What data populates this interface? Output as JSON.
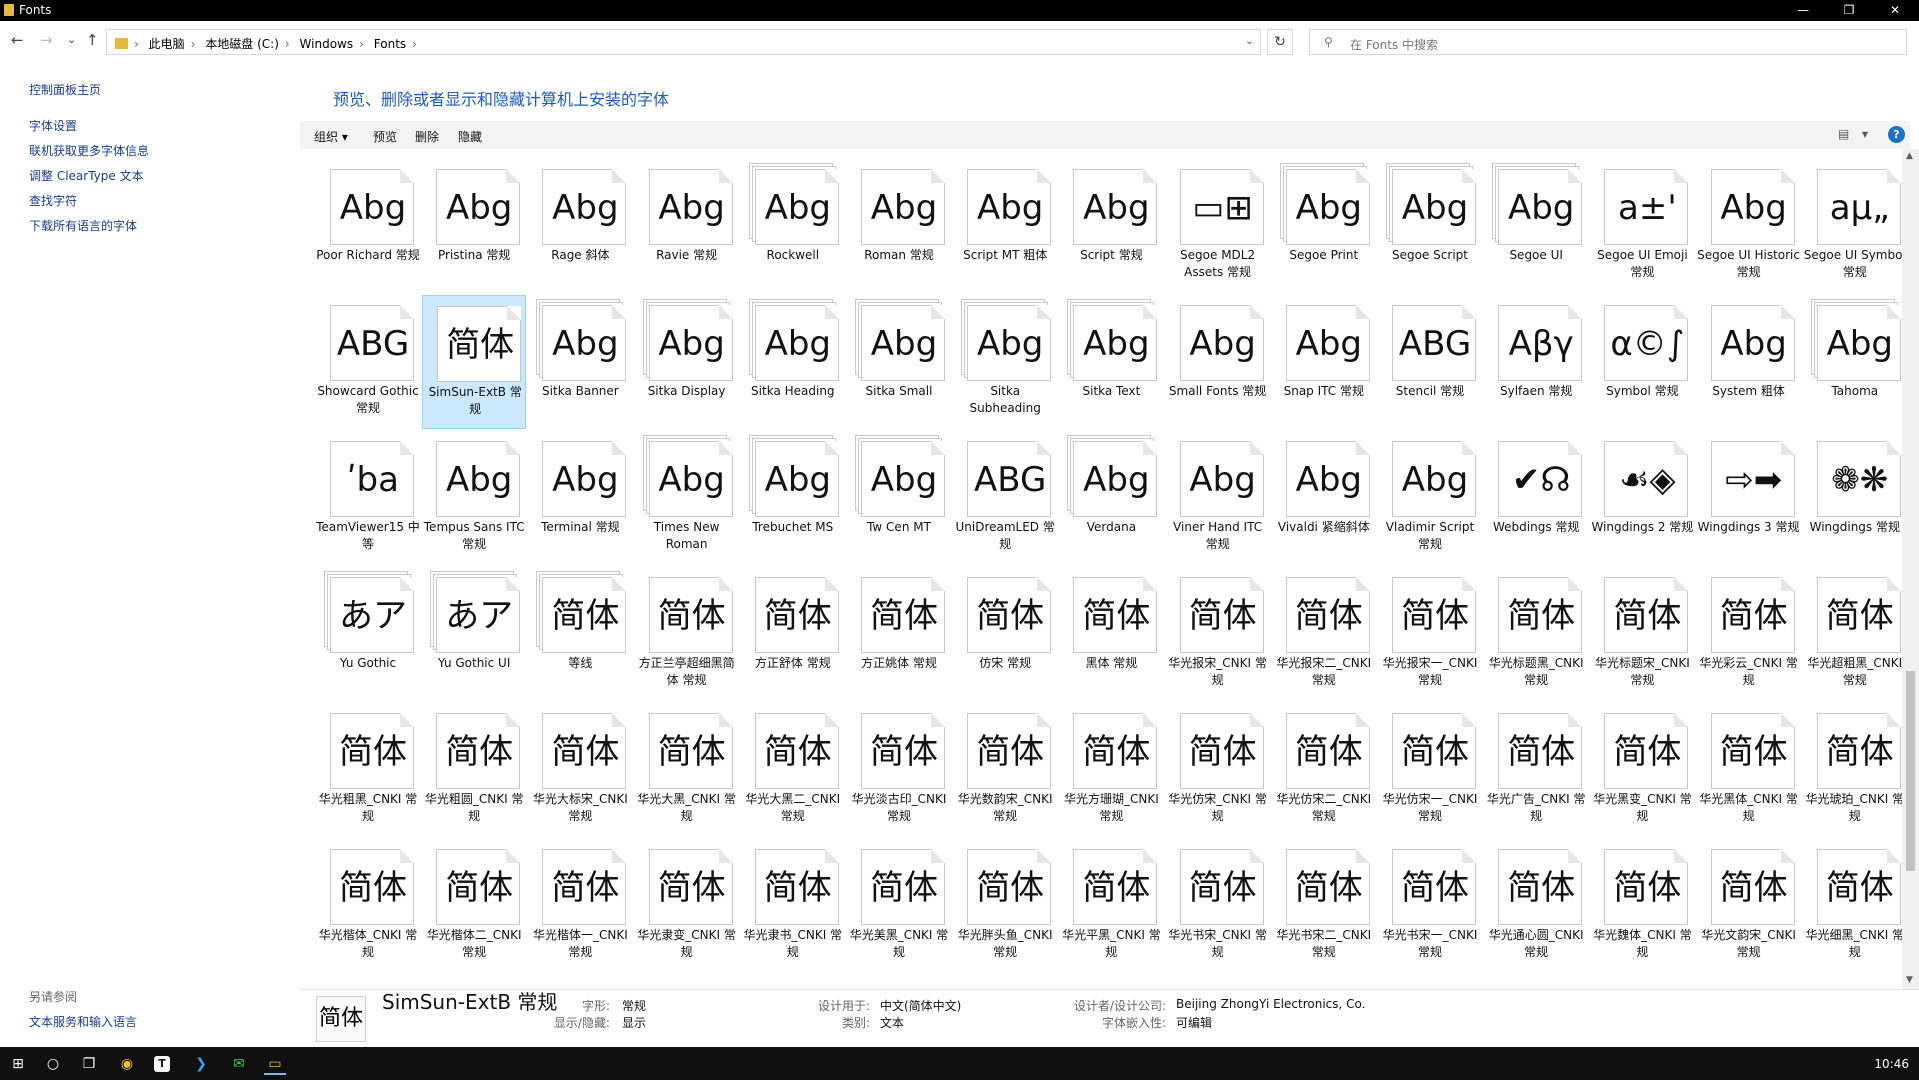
{
  "window": {
    "title": "Fonts",
    "min": "—",
    "max": "❐",
    "close": "✕"
  },
  "nav": {
    "back": "←",
    "forward": "→",
    "recent": "⌄",
    "up": "↑",
    "breadcrumbs": [
      "此电脑",
      "本地磁盘 (C:)",
      "Windows",
      "Fonts"
    ],
    "dropdown": "⌄",
    "refresh": "↻"
  },
  "search": {
    "icon": "⚲",
    "placeholder": "在 Fonts 中搜索"
  },
  "left_pane": {
    "links": [
      "控制面板主页",
      "字体设置",
      "联机获取更多字体信息",
      "调整 ClearType 文本",
      "查找字符",
      "下载所有语言的字体"
    ],
    "see_also": "另请参阅",
    "see_also_links": [
      "文本服务和输入语言"
    ]
  },
  "main": {
    "heading": "预览、删除或者显示和隐藏计算机上安装的字体"
  },
  "toolbar": {
    "organize": "组织 ▾",
    "preview": "预览",
    "delete": "删除",
    "hide": "隐藏",
    "view": "▤",
    "view_dd": "▾",
    "help": "?"
  },
  "fonts": [
    {
      "name": "Poor Richard 常规",
      "sample": "Abg",
      "stack": 1
    },
    {
      "name": "Pristina 常规",
      "sample": "Abg",
      "stack": 1
    },
    {
      "name": "Rage 斜体",
      "sample": "Abg",
      "stack": 1
    },
    {
      "name": "Ravie 常规",
      "sample": "Abg",
      "stack": 1
    },
    {
      "name": "Rockwell",
      "sample": "Abg",
      "stack": 3
    },
    {
      "name": "Roman 常规",
      "sample": "Abg",
      "stack": 1
    },
    {
      "name": "Script MT 粗体",
      "sample": "Abg",
      "stack": 1
    },
    {
      "name": "Script 常规",
      "sample": "Abg",
      "stack": 1
    },
    {
      "name": "Segoe MDL2 Assets 常规",
      "sample": "▭⊞",
      "stack": 1
    },
    {
      "name": "Segoe Print",
      "sample": "Abg",
      "stack": 3
    },
    {
      "name": "Segoe Script",
      "sample": "Abg",
      "stack": 3
    },
    {
      "name": "Segoe UI",
      "sample": "Abg",
      "stack": 3
    },
    {
      "name": "Segoe UI Emoji 常规",
      "sample": "a±'",
      "stack": 1
    },
    {
      "name": "Segoe UI Historic 常规",
      "sample": "Abg",
      "stack": 1
    },
    {
      "name": "Segoe UI Symbol 常规",
      "sample": "aμ„",
      "stack": 1
    },
    {
      "name": "Showcard Gothic 常规",
      "sample": "ABG",
      "stack": 1
    },
    {
      "name": "SimSun-ExtB 常规",
      "sample": "简体",
      "stack": 1,
      "selected": true
    },
    {
      "name": "Sitka Banner",
      "sample": "Abg",
      "stack": 3
    },
    {
      "name": "Sitka Display",
      "sample": "Abg",
      "stack": 3
    },
    {
      "name": "Sitka Heading",
      "sample": "Abg",
      "stack": 3
    },
    {
      "name": "Sitka Small",
      "sample": "Abg",
      "stack": 3
    },
    {
      "name": "Sitka Subheading",
      "sample": "Abg",
      "stack": 3
    },
    {
      "name": "Sitka Text",
      "sample": "Abg",
      "stack": 3
    },
    {
      "name": "Small Fonts 常规",
      "sample": "Abg",
      "stack": 1
    },
    {
      "name": "Snap ITC 常规",
      "sample": "Abg",
      "stack": 1
    },
    {
      "name": "Stencil 常规",
      "sample": "ABG",
      "stack": 1
    },
    {
      "name": "Sylfaen 常规",
      "sample": "Αβγ",
      "stack": 1
    },
    {
      "name": "Symbol 常规",
      "sample": "α©∫",
      "stack": 1
    },
    {
      "name": "System 粗体",
      "sample": "Abg",
      "stack": 1
    },
    {
      "name": "Tahoma",
      "sample": "Abg",
      "stack": 3
    },
    {
      "name": "TeamViewer15 中等",
      "sample": "ʹba",
      "stack": 1
    },
    {
      "name": "Tempus Sans ITC 常规",
      "sample": "Abg",
      "stack": 1
    },
    {
      "name": "Terminal 常规",
      "sample": "Abg",
      "stack": 1
    },
    {
      "name": "Times New Roman",
      "sample": "Abg",
      "stack": 3
    },
    {
      "name": "Trebuchet MS",
      "sample": "Abg",
      "stack": 3
    },
    {
      "name": "Tw Cen MT",
      "sample": "Abg",
      "stack": 3
    },
    {
      "name": "UniDreamLED 常规",
      "sample": "ABG",
      "stack": 1
    },
    {
      "name": "Verdana",
      "sample": "Abg",
      "stack": 3
    },
    {
      "name": "Viner Hand ITC 常规",
      "sample": "Abg",
      "stack": 1
    },
    {
      "name": "Vivaldi 紧缩斜体",
      "sample": "Abg",
      "stack": 1
    },
    {
      "name": "Vladimir Script 常规",
      "sample": "Abg",
      "stack": 1
    },
    {
      "name": "Webdings 常规",
      "sample": "✔☊",
      "stack": 1
    },
    {
      "name": "Wingdings 2 常规",
      "sample": "☙◈",
      "stack": 1
    },
    {
      "name": "Wingdings 3 常规",
      "sample": "⇨➡",
      "stack": 1
    },
    {
      "name": "Wingdings 常规",
      "sample": "❁❋",
      "stack": 1
    },
    {
      "name": "Yu Gothic",
      "sample": "あア",
      "stack": 3
    },
    {
      "name": "Yu Gothic UI",
      "sample": "あア",
      "stack": 3
    },
    {
      "name": "等线",
      "sample": "简体",
      "stack": 3
    },
    {
      "name": "方正兰亭超细黑简体 常规",
      "sample": "简体",
      "stack": 1
    },
    {
      "name": "方正舒体 常规",
      "sample": "简体",
      "stack": 1
    },
    {
      "name": "方正姚体 常规",
      "sample": "简体",
      "stack": 1
    },
    {
      "name": "仿宋 常规",
      "sample": "简体",
      "stack": 1
    },
    {
      "name": "黑体 常规",
      "sample": "简体",
      "stack": 1
    },
    {
      "name": "华光报宋_CNKI 常规",
      "sample": "简体",
      "stack": 1
    },
    {
      "name": "华光报宋二_CNKI 常规",
      "sample": "简体",
      "stack": 1
    },
    {
      "name": "华光报宋一_CNKI 常规",
      "sample": "简体",
      "stack": 1
    },
    {
      "name": "华光标题黑_CNKI 常规",
      "sample": "简体",
      "stack": 1
    },
    {
      "name": "华光标题宋_CNKI 常规",
      "sample": "简体",
      "stack": 1
    },
    {
      "name": "华光彩云_CNKI 常规",
      "sample": "简体",
      "stack": 1
    },
    {
      "name": "华光超粗黑_CNKI 常规",
      "sample": "简体",
      "stack": 1
    },
    {
      "name": "华光粗黑_CNKI 常规",
      "sample": "简体",
      "stack": 1
    },
    {
      "name": "华光粗圆_CNKI 常规",
      "sample": "简体",
      "stack": 1
    },
    {
      "name": "华光大标宋_CNKI 常规",
      "sample": "简体",
      "stack": 1
    },
    {
      "name": "华光大黑_CNKI 常规",
      "sample": "简体",
      "stack": 1
    },
    {
      "name": "华光大黑二_CNKI 常规",
      "sample": "简体",
      "stack": 1
    },
    {
      "name": "华光淡古印_CNKI 常规",
      "sample": "简体",
      "stack": 1
    },
    {
      "name": "华光数韵宋_CNKI 常规",
      "sample": "简体",
      "stack": 1
    },
    {
      "name": "华光方珊瑚_CNKI 常规",
      "sample": "简体",
      "stack": 1
    },
    {
      "name": "华光仿宋_CNKI 常规",
      "sample": "简体",
      "stack": 1
    },
    {
      "name": "华光仿宋二_CNKI 常规",
      "sample": "简体",
      "stack": 1
    },
    {
      "name": "华光仿宋一_CNKI 常规",
      "sample": "简体",
      "stack": 1
    },
    {
      "name": "华光广告_CNKI 常规",
      "sample": "简体",
      "stack": 1
    },
    {
      "name": "华光黑变_CNKI 常规",
      "sample": "简体",
      "stack": 1
    },
    {
      "name": "华光黑体_CNKI 常规",
      "sample": "简体",
      "stack": 1
    },
    {
      "name": "华光琥珀_CNKI 常规",
      "sample": "简体",
      "stack": 1
    },
    {
      "name": "华光楷体_CNKI 常规",
      "sample": "简体",
      "stack": 1
    },
    {
      "name": "华光楷体二_CNKI 常规",
      "sample": "简体",
      "stack": 1
    },
    {
      "name": "华光楷体一_CNKI 常规",
      "sample": "简体",
      "stack": 1
    },
    {
      "name": "华光隶变_CNKI 常规",
      "sample": "简体",
      "stack": 1
    },
    {
      "name": "华光隶书_CNKI 常规",
      "sample": "简体",
      "stack": 1
    },
    {
      "name": "华光美黑_CNKI 常规",
      "sample": "简体",
      "stack": 1
    },
    {
      "name": "华光胖头鱼_CNKI 常规",
      "sample": "简体",
      "stack": 1
    },
    {
      "name": "华光平黑_CNKI 常规",
      "sample": "简体",
      "stack": 1
    },
    {
      "name": "华光书宋_CNKI 常规",
      "sample": "简体",
      "stack": 1
    },
    {
      "name": "华光书宋二_CNKI 常规",
      "sample": "简体",
      "stack": 1
    },
    {
      "name": "华光书宋一_CNKI 常规",
      "sample": "简体",
      "stack": 1
    },
    {
      "name": "华光通心圆_CNKI 常规",
      "sample": "简体",
      "stack": 1
    },
    {
      "name": "华光魏体_CNKI 常规",
      "sample": "简体",
      "stack": 1
    },
    {
      "name": "华光文韵宋_CNKI 常规",
      "sample": "简体",
      "stack": 1
    },
    {
      "name": "华光细黑_CNKI 常规",
      "sample": "简体",
      "stack": 1
    }
  ],
  "details": {
    "sample": "简体",
    "name": "SimSun-ExtB 常规",
    "style_key": "字形:",
    "style_val": "常规",
    "show_key": "显示/隐藏:",
    "show_val": "显示",
    "design_key": "设计用于:",
    "design_val": "中文(简体中文)",
    "cat_key": "类别:",
    "cat_val": "文本",
    "designer_key": "设计者/设计公司:",
    "designer_val": "Beijing ZhongYi Electronics, Co.",
    "embed_key": "字体嵌入性:",
    "embed_val": "可编辑"
  },
  "scrollbar": {
    "up": "▲",
    "down": "▼"
  },
  "taskbar": {
    "start": "⊞",
    "search": "○",
    "taskview": "❐",
    "chrome": "◉",
    "app1": "T",
    "vscode": "❯",
    "wechat": "✉",
    "explorer": "▭",
    "clock": "10:46"
  }
}
